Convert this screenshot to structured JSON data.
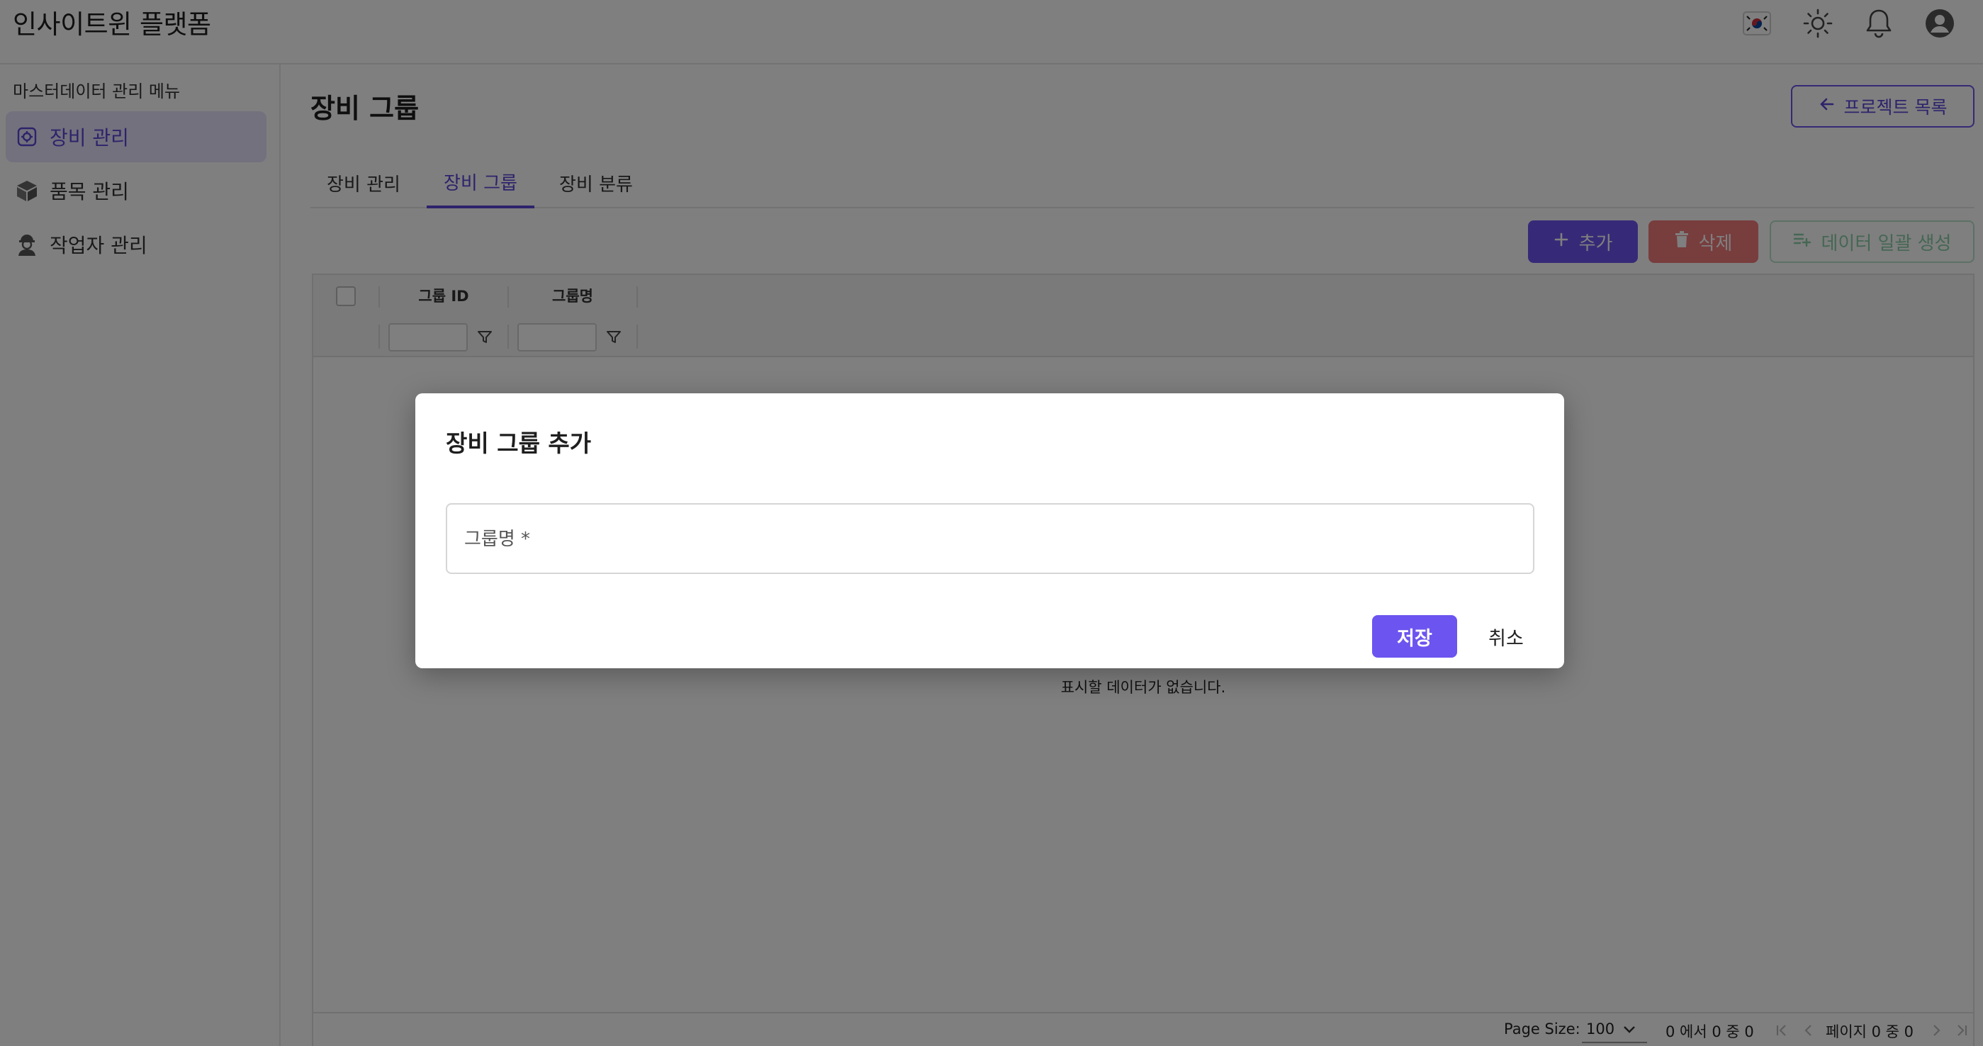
{
  "header": {
    "title": "인사이트윈 플랫폼",
    "icons": [
      "korea-flag-icon",
      "sun-icon",
      "bell-icon",
      "user-avatar-icon"
    ]
  },
  "sidebar": {
    "heading": "마스터데이터 관리 메뉴",
    "items": [
      {
        "label": "장비 관리",
        "icon": "equipment-icon",
        "active": true
      },
      {
        "label": "품목 관리",
        "icon": "box-icon",
        "active": false
      },
      {
        "label": "작업자 관리",
        "icon": "worker-icon",
        "active": false
      }
    ]
  },
  "main": {
    "title": "장비 그룹",
    "back_button": "프로젝트 목록",
    "tabs": [
      {
        "label": "장비 관리",
        "active": false
      },
      {
        "label": "장비 그룹",
        "active": true
      },
      {
        "label": "장비 분류",
        "active": false
      }
    ],
    "toolbar": {
      "add": "추가",
      "delete": "삭제",
      "bulk": "데이터 일괄 생성"
    },
    "grid": {
      "columns": [
        "그룹 ID",
        "그룹명"
      ],
      "no_data": "표시할 데이터가 없습니다.",
      "page_size_label": "Page Size:",
      "page_size": "100",
      "range_text": "0 에서 0 중 0",
      "page_text": "페이지 0 중 0"
    }
  },
  "modal": {
    "title": "장비 그룹 추가",
    "field_label": "그룹명 *",
    "field_value": "",
    "save": "저장",
    "cancel": "취소"
  },
  "colors": {
    "accent": "#6c54f0",
    "danger": "#f07a7a",
    "success_outline": "#b9e3cd"
  }
}
